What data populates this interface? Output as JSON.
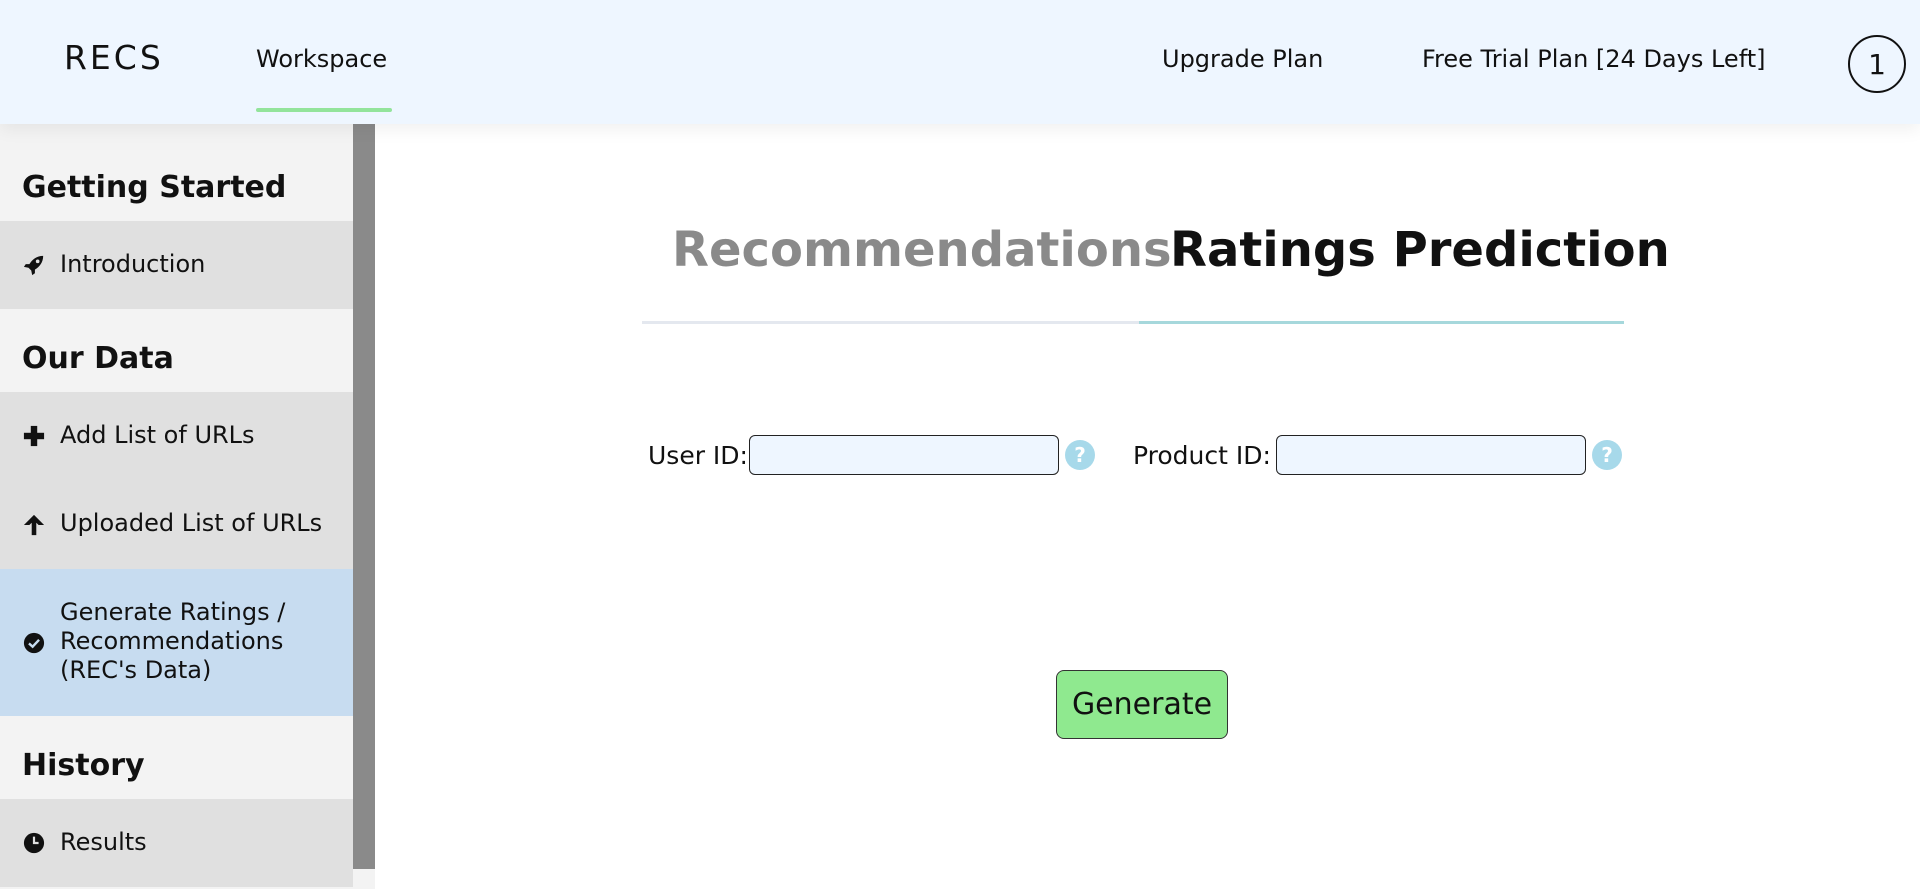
{
  "header": {
    "brand": "RECS",
    "nav_workspace": "Workspace",
    "nav_upgrade": "Upgrade Plan",
    "nav_plan": "Free Trial Plan [24 Days Left]",
    "avatar": "1"
  },
  "sidebar": {
    "sections": {
      "getting_started": "Getting Started",
      "our_data": "Our Data",
      "history": "History"
    },
    "items": {
      "introduction": {
        "label": "Introduction",
        "icon": "rocket-icon"
      },
      "add_urls": {
        "label": "Add List of URLs",
        "icon": "plus-icon"
      },
      "uploaded_urls": {
        "label": "Uploaded List of URLs",
        "icon": "arrow-up-icon"
      },
      "generate": {
        "label": "Generate Ratings /\nRecommendations\n(REC's Data)",
        "icon": "check-circle-icon"
      },
      "results": {
        "label": "Results",
        "icon": "clock-icon"
      }
    }
  },
  "main": {
    "tabs": {
      "recommendations": "Recommendations",
      "ratings_prediction": "Ratings Prediction"
    },
    "active_tab": "Ratings Prediction",
    "fields": {
      "user_id_label": "User ID:",
      "user_id_value": "",
      "product_id_label": "Product ID:",
      "product_id_value": "",
      "help_glyph": "?"
    },
    "generate_label": "Generate"
  },
  "colors": {
    "header_bg": "#eef6ff",
    "tab_underline_accent": "#93e49b",
    "active_sidebar_item": "#c7dcf0",
    "generate_button": "#8fe98f",
    "help_icon": "#a7d9ea"
  }
}
